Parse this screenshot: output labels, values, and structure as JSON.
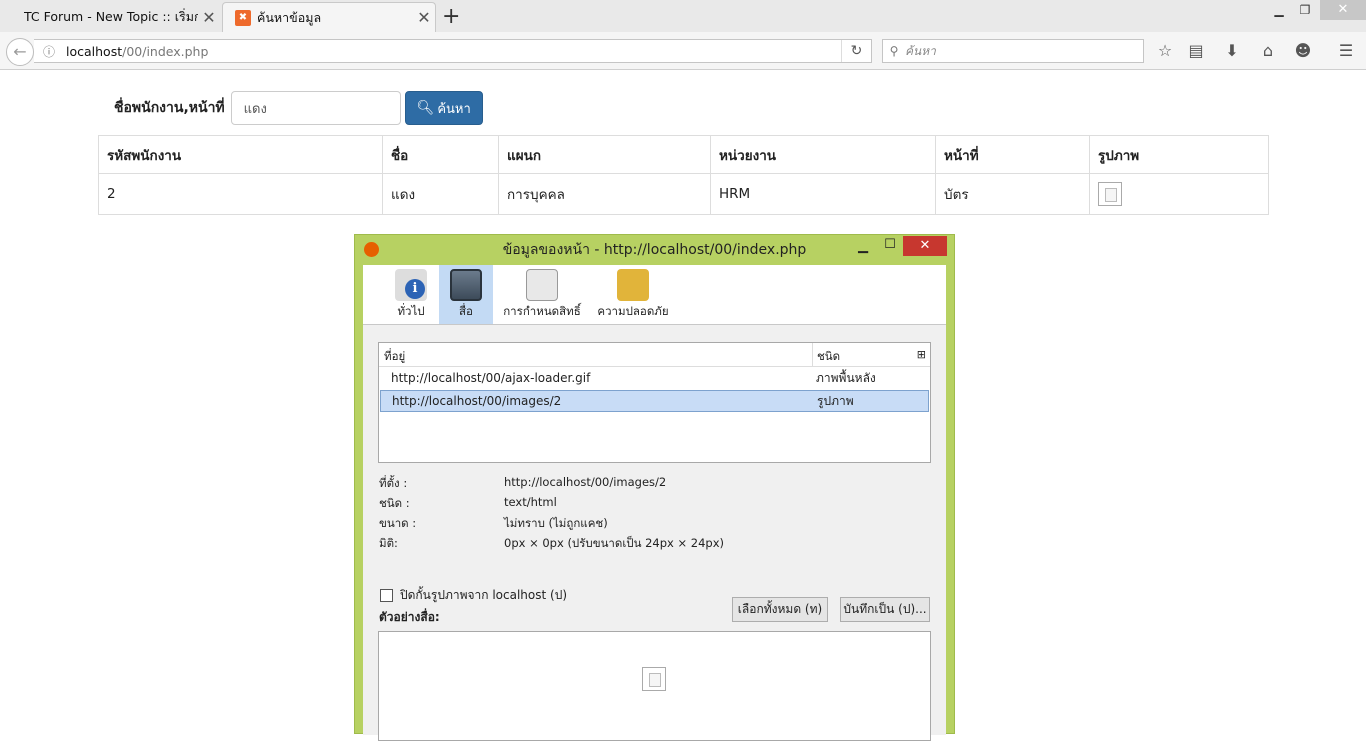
{
  "browser": {
    "tabs": [
      {
        "title": "TC Forum - New Topic :: เริ่มกร..."
      },
      {
        "title": "ค้นหาข้อมูล"
      }
    ],
    "url_host": "localhost",
    "url_path": "/00/index.php",
    "search_placeholder": "ค้นหา"
  },
  "page": {
    "search_label": "ชื่อพนักงาน,หน้าที่",
    "search_value": "แดง",
    "search_button": "ค้นหา",
    "table": {
      "headers": [
        "รหัสพนักงาน",
        "ชื่อ",
        "แผนก",
        "หน่วยงาน",
        "หน้าที่",
        "รูปภาพ"
      ],
      "rows": [
        {
          "id": "2",
          "name": "แดง",
          "dept": "การบุคคล",
          "unit": "HRM",
          "role": "บัตร"
        }
      ]
    }
  },
  "dialog": {
    "title": "ข้อมูลของหน้า - http://localhost/00/index.php",
    "tabs": [
      "ทั่วไป",
      "สื่อ",
      "การกำหนดสิทธิ์",
      "ความปลอดภัย"
    ],
    "list": {
      "col_address": "ที่อยู่",
      "col_type": "ชนิด",
      "rows": [
        {
          "address": "http://localhost/00/ajax-loader.gif",
          "type": "ภาพพื้นหลัง"
        },
        {
          "address": "http://localhost/00/images/2",
          "type": "รูปภาพ"
        }
      ]
    },
    "props": [
      {
        "key": "ที่ตั้ง :",
        "value": "http://localhost/00/images/2"
      },
      {
        "key": "ชนิด :",
        "value": "text/html"
      },
      {
        "key": "ขนาด :",
        "value": "ไม่ทราบ (ไม่ถูกแคช)"
      },
      {
        "key": "มิติ:",
        "value": "0px × 0px (ปรับขนาดเป็น 24px × 24px)"
      }
    ],
    "block_label": "ปิดกั้นรูปภาพจาก localhost (ป)",
    "select_all": "เลือกทั้งหมด (ท)",
    "save_as": "บันทึกเป็น (ป)...",
    "preview_label": "ตัวอย่างสื่อ:"
  }
}
